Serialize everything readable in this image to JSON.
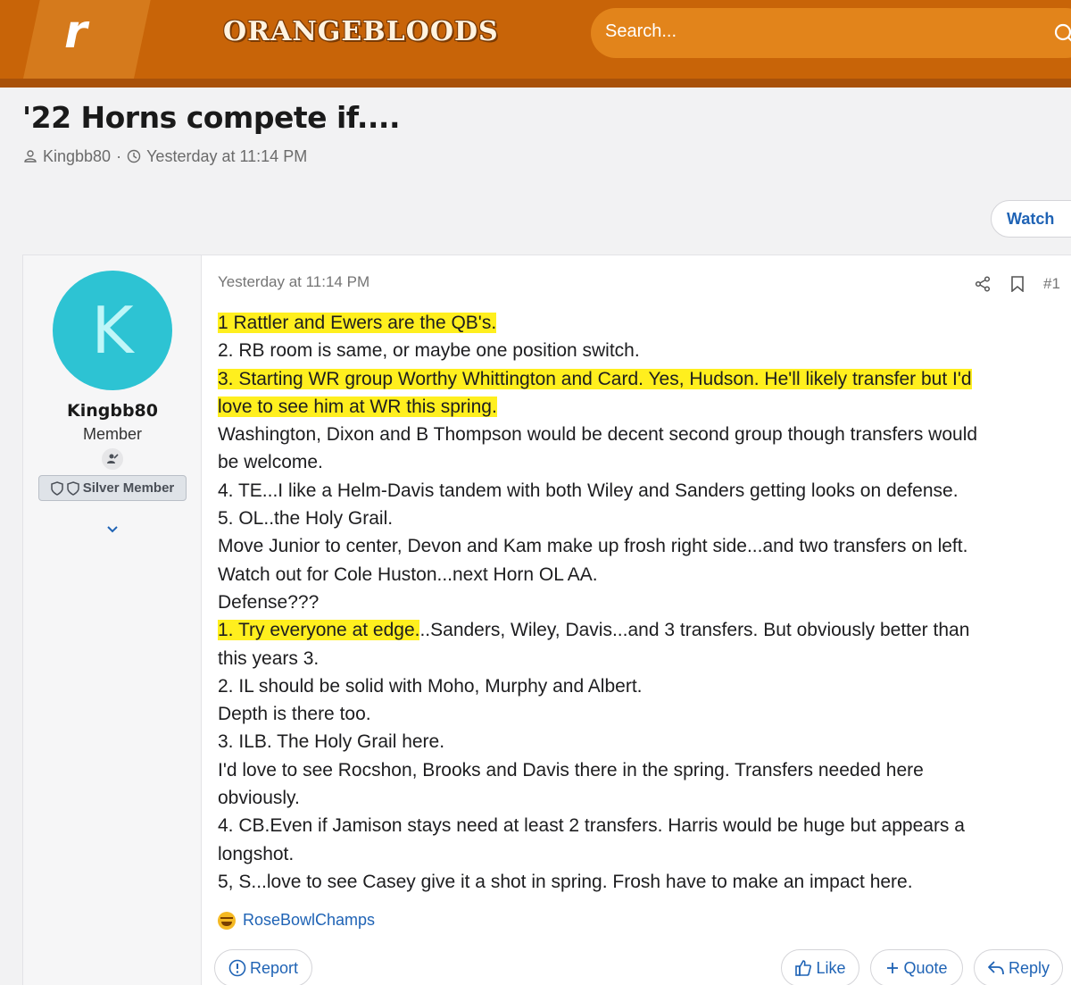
{
  "header": {
    "logo_letter": "r",
    "brand": "ORANGEBLOODS",
    "search_placeholder": "Search..."
  },
  "thread": {
    "title": "'22 Horns compete if....",
    "author": "Kingbb80",
    "separator": "·",
    "posted": "Yesterday at 11:14 PM",
    "watch_label": "Watch"
  },
  "post": {
    "avatar_letter": "K",
    "username": "Kingbb80",
    "user_title": "Member",
    "banner": "Silver Member",
    "date": "Yesterday at 11:14 PM",
    "number": "#1",
    "lines": [
      {
        "hl": "1 Rattler and Ewers are the QB's.",
        "rest": ""
      },
      {
        "hl": "",
        "rest": "2. RB room is same, or maybe one position switch."
      },
      {
        "hl": "3. Starting WR group Worthy Whittington and Card. Yes, Hudson. He'll likely transfer but I'd",
        "rest": ""
      },
      {
        "hl": "love to see him at WR this spring.",
        "rest": ""
      },
      {
        "hl": "",
        "rest": "Washington, Dixon and B Thompson would be decent second group though transfers would"
      },
      {
        "hl": "",
        "rest": "be welcome."
      },
      {
        "hl": "",
        "rest": "4. TE...I like a Helm-Davis tandem with both Wiley and Sanders getting looks on defense."
      },
      {
        "hl": "",
        "rest": "5. OL..the Holy Grail."
      },
      {
        "hl": "",
        "rest": "Move Junior to center, Devon and Kam make up frosh right side...and two transfers on left."
      },
      {
        "hl": "",
        "rest": "Watch out for Cole Huston...next Horn OL AA."
      },
      {
        "hl": "",
        "rest": "Defense???"
      },
      {
        "hl": "1. Try everyone at edge.",
        "rest": "..Sanders, Wiley, Davis...and 3 transfers. But obviously better than"
      },
      {
        "hl": "",
        "rest": "this years 3."
      },
      {
        "hl": "",
        "rest": "2. IL should be solid with Moho, Murphy and Albert."
      },
      {
        "hl": "",
        "rest": "Depth is there too."
      },
      {
        "hl": "",
        "rest": "3. ILB. The Holy Grail here."
      },
      {
        "hl": "",
        "rest": "I'd love to see Rocshon, Brooks and Davis there in the spring. Transfers needed here"
      },
      {
        "hl": "",
        "rest": "obviously."
      },
      {
        "hl": "",
        "rest": "4. CB.Even if Jamison stays need at least 2 transfers. Harris would be huge but appears a"
      },
      {
        "hl": "",
        "rest": "longshot."
      },
      {
        "hl": "",
        "rest": "5, S...love to see Casey give it a shot in spring. Frosh have to make an impact here."
      }
    ],
    "reaction_user": "RoseBowlChamps",
    "report_label": "Report",
    "like_label": "Like",
    "quote_label": "Quote",
    "reply_label": "Reply"
  },
  "colors": {
    "header_bg": "#c86408",
    "search_bg": "#e2841b",
    "avatar_bg": "#2dc3d3",
    "link": "#1f63b5",
    "highlight": "#ffef1e"
  }
}
